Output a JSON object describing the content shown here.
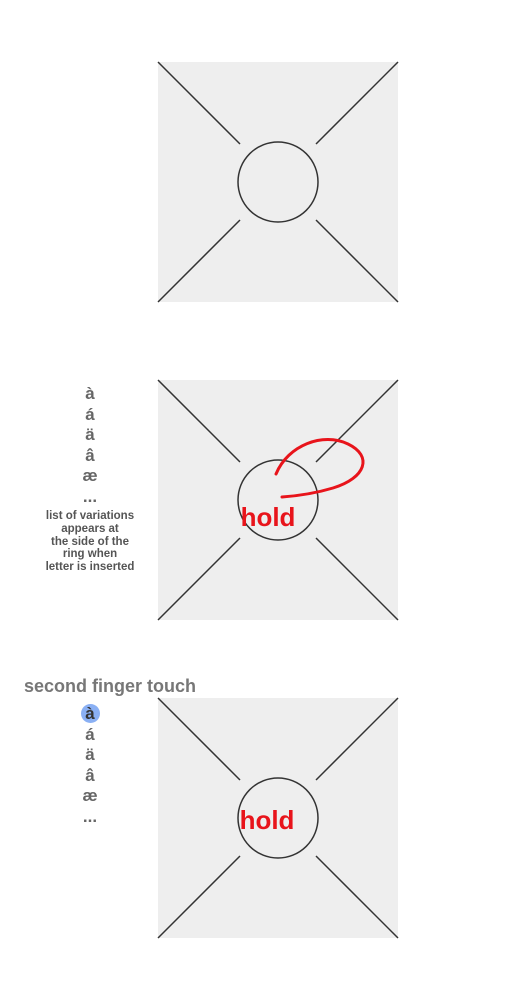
{
  "panels": [
    {
      "hold_label": ""
    },
    {
      "hold_label": "hold"
    },
    {
      "hold_label": "hold"
    }
  ],
  "variations": [
    "à",
    "á",
    "ä",
    "â",
    "æ",
    "..."
  ],
  "selected_variation_index": 0,
  "note_lines": [
    "list of variations",
    "appears at",
    "the side of the",
    "ring when",
    "letter is inserted"
  ],
  "second_finger_heading": "second finger touch",
  "colors": {
    "panel_fill": "#eeeeee",
    "stroke": "#333333",
    "accent": "#e8141b",
    "selection": "#8ab0f4"
  }
}
